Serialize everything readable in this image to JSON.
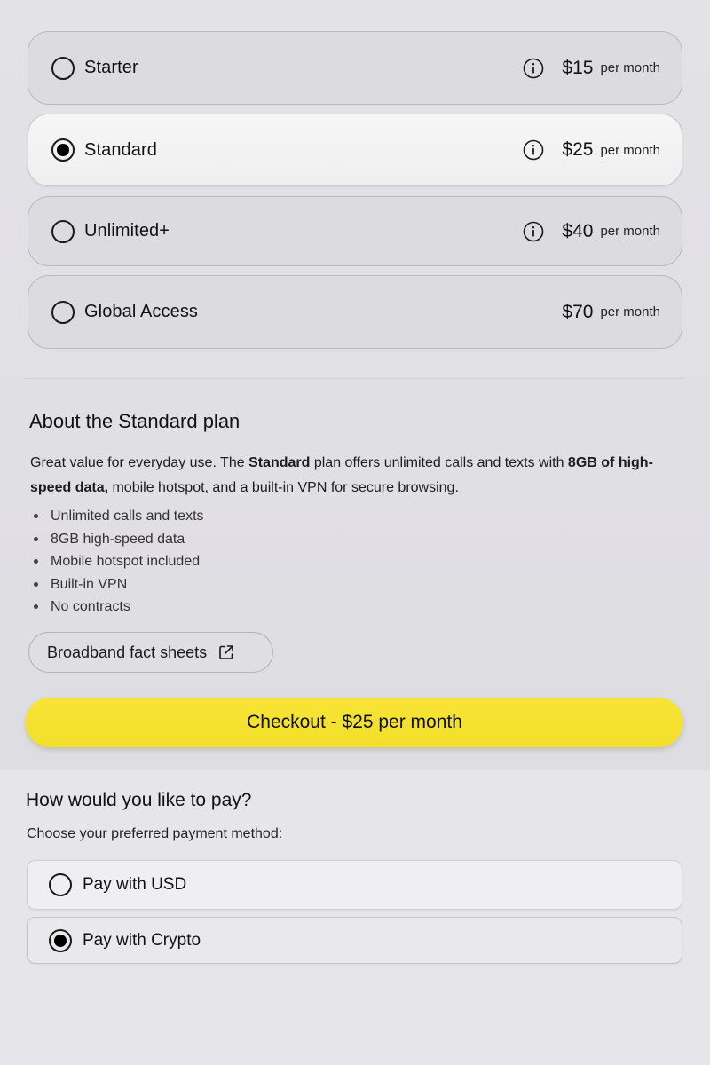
{
  "plans": [
    {
      "name": "Starter",
      "price": "$15",
      "period": "per month",
      "selected": false,
      "has_info": true
    },
    {
      "name": "Standard",
      "price": "$25",
      "period": "per month",
      "selected": true,
      "has_info": true
    },
    {
      "name": "Unlimited+",
      "price": "$40",
      "period": "per month",
      "selected": false,
      "has_info": true
    },
    {
      "name": "Global Access",
      "price": "$70",
      "period": "per month",
      "selected": false,
      "has_info": false
    }
  ],
  "about": {
    "title": "About the Standard plan",
    "desc_1": "Great value for everyday use. The ",
    "desc_bold_1": "Standard",
    "desc_2": " plan offers unlimited calls and texts with ",
    "desc_bold_2": "8GB of high-speed data,",
    "desc_3": " mobile hotspot, and a built-in VPN for secure browsing.",
    "features": [
      "Unlimited calls and texts",
      "8GB high-speed data",
      "Mobile hotspot included",
      "Built-in VPN",
      "No contracts"
    ]
  },
  "fact_sheets": {
    "label": "Broadband fact sheets",
    "icon": "external-link-icon"
  },
  "checkout": {
    "label": "Checkout - $25 per month"
  },
  "payment": {
    "title": "How would you like to pay?",
    "subtitle": "Choose your preferred payment method:",
    "options": [
      {
        "label": "Pay with USD",
        "selected": false
      },
      {
        "label": "Pay with Crypto",
        "selected": true
      }
    ]
  },
  "colors": {
    "accent": "#f4e12e",
    "background": "#e0dfe4",
    "selected_card": "#f3f3f4"
  }
}
